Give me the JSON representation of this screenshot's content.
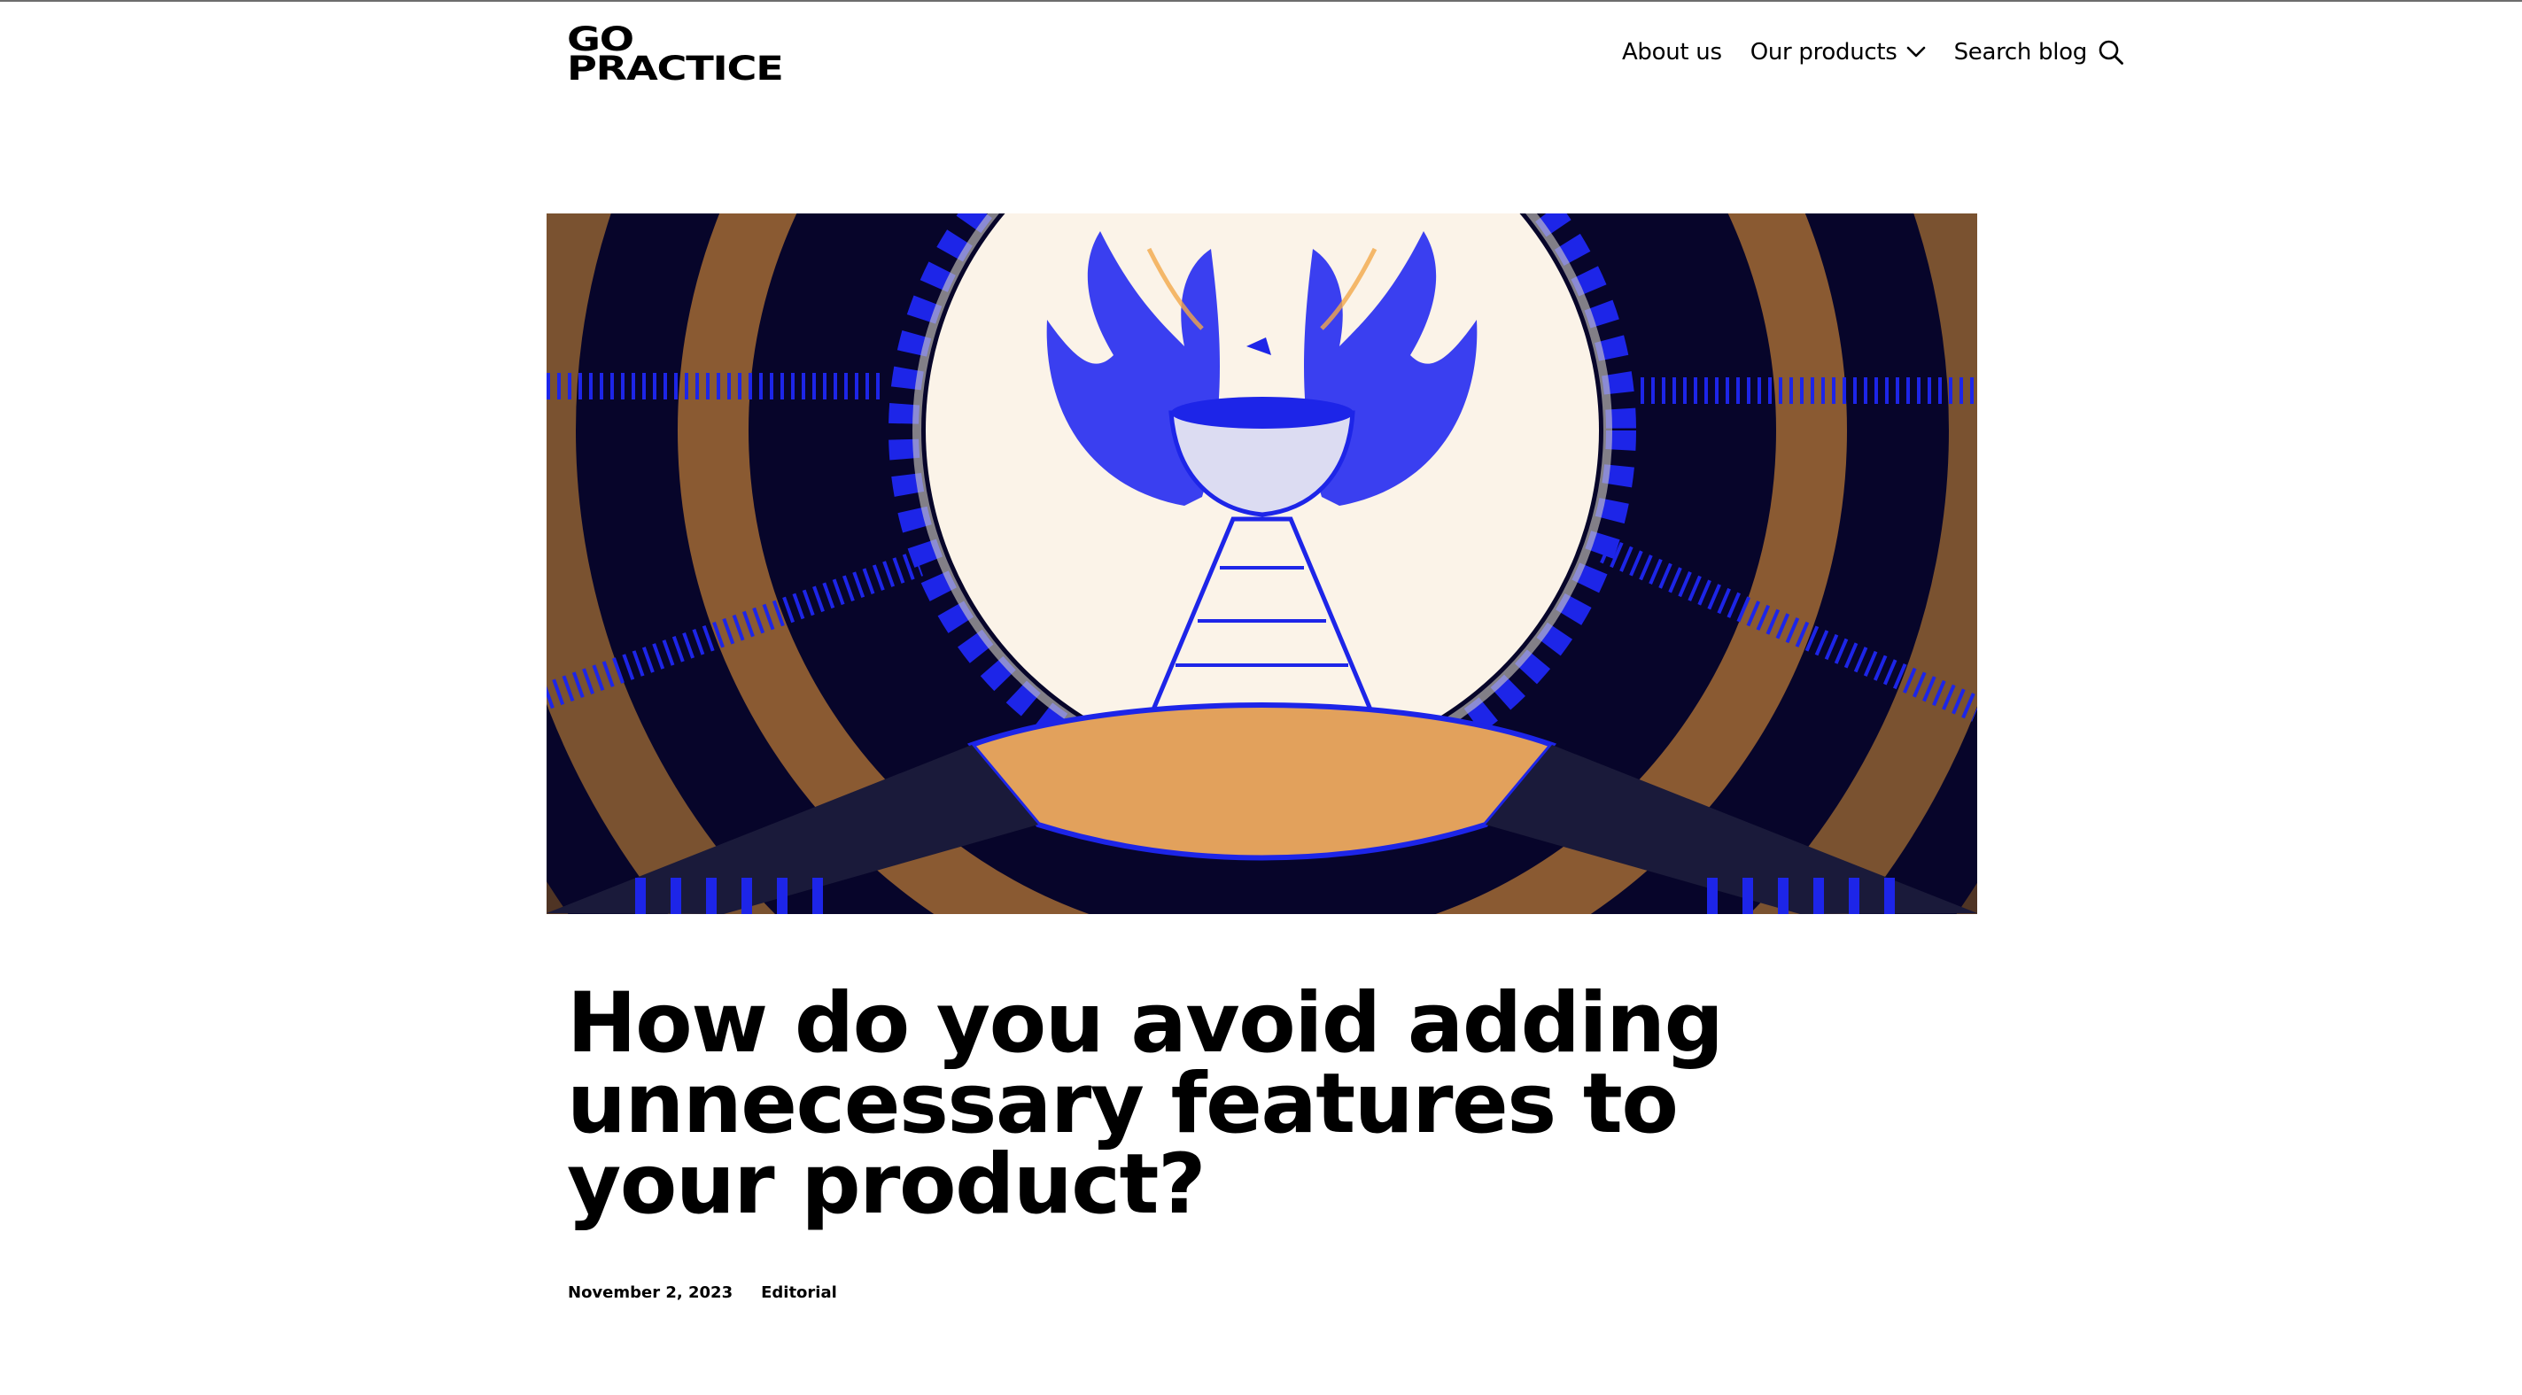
{
  "header": {
    "logo_line1": "GO",
    "logo_line2": "PRACTICE",
    "nav": {
      "about_label": "About us",
      "products_label": "Our products",
      "search_label": "Search blog"
    }
  },
  "hero": {
    "colors": {
      "background": "#07052a",
      "ring_brown": "#7a5230",
      "accent_blue": "#1d25e8",
      "sun": "#fbf3e8",
      "flame": "#f2a848"
    }
  },
  "article": {
    "title": "How do you avoid adding unnecessary features to your product?",
    "date": "November 2, 2023",
    "category": "Editorial"
  }
}
